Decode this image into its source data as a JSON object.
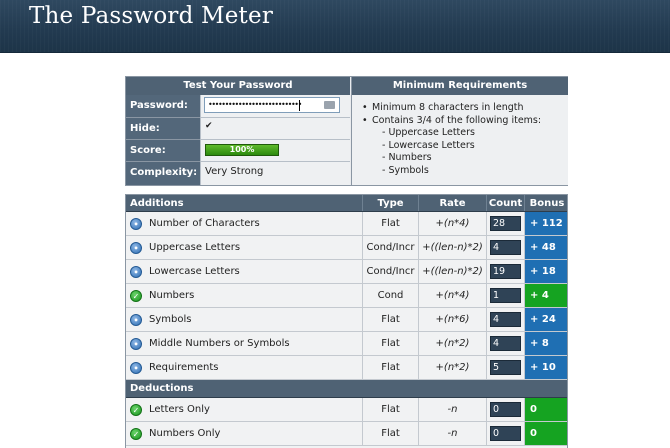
{
  "header": {
    "title": "The Password Meter"
  },
  "test": {
    "heading": "Test Your Password",
    "password_label": "Password:",
    "password_dots": "••••••••••••••••••••••••••••",
    "hide_label": "Hide:",
    "hide_checked": true,
    "hide_mark": "✔",
    "score_label": "Score:",
    "score_value": "100%",
    "score_fraction": 1.0,
    "complexity_label": "Complexity:",
    "complexity_value": "Very Strong"
  },
  "requirements": {
    "heading": "Minimum Requirements",
    "lines": [
      {
        "text": "Minimum 8 characters in length",
        "kind": "bullet"
      },
      {
        "text": "Contains 3/4 of the following items:",
        "kind": "bullet"
      },
      {
        "text": "- Uppercase Letters",
        "kind": "sub"
      },
      {
        "text": "- Lowercase Letters",
        "kind": "sub"
      },
      {
        "text": "- Numbers",
        "kind": "sub"
      },
      {
        "text": "- Symbols",
        "kind": "sub"
      }
    ]
  },
  "table": {
    "columns": {
      "name": "Additions",
      "type": "Type",
      "rate": "Rate",
      "count": "Count",
      "bonus": "Bonus"
    },
    "additions": [
      {
        "name": "Number of Characters",
        "type": "Flat",
        "rate": "+(n*4)",
        "count": "28",
        "bonus": "+ 112",
        "status": "blue"
      },
      {
        "name": "Uppercase Letters",
        "type": "Cond/Incr",
        "rate": "+((len-n)*2)",
        "count": "4",
        "bonus": "+ 48",
        "status": "blue"
      },
      {
        "name": "Lowercase Letters",
        "type": "Cond/Incr",
        "rate": "+((len-n)*2)",
        "count": "19",
        "bonus": "+ 18",
        "status": "blue"
      },
      {
        "name": "Numbers",
        "type": "Cond",
        "rate": "+(n*4)",
        "count": "1",
        "bonus": "+ 4",
        "status": "green"
      },
      {
        "name": "Symbols",
        "type": "Flat",
        "rate": "+(n*6)",
        "count": "4",
        "bonus": "+ 24",
        "status": "blue"
      },
      {
        "name": "Middle Numbers or Symbols",
        "type": "Flat",
        "rate": "+(n*2)",
        "count": "4",
        "bonus": "+ 8",
        "status": "blue"
      },
      {
        "name": "Requirements",
        "type": "Flat",
        "rate": "+(n*2)",
        "count": "5",
        "bonus": "+ 10",
        "status": "blue"
      }
    ],
    "deductions_label": "Deductions",
    "deductions": [
      {
        "name": "Letters Only",
        "type": "Flat",
        "rate": "-n",
        "count": "0",
        "bonus": "0",
        "status": "green"
      },
      {
        "name": "Numbers Only",
        "type": "Flat",
        "rate": "-n",
        "count": "0",
        "bonus": "0",
        "status": "green"
      }
    ]
  },
  "colors": {
    "blue_status": "#1f6fb3",
    "green_status": "#15a321",
    "header_bg": "#223a50"
  }
}
